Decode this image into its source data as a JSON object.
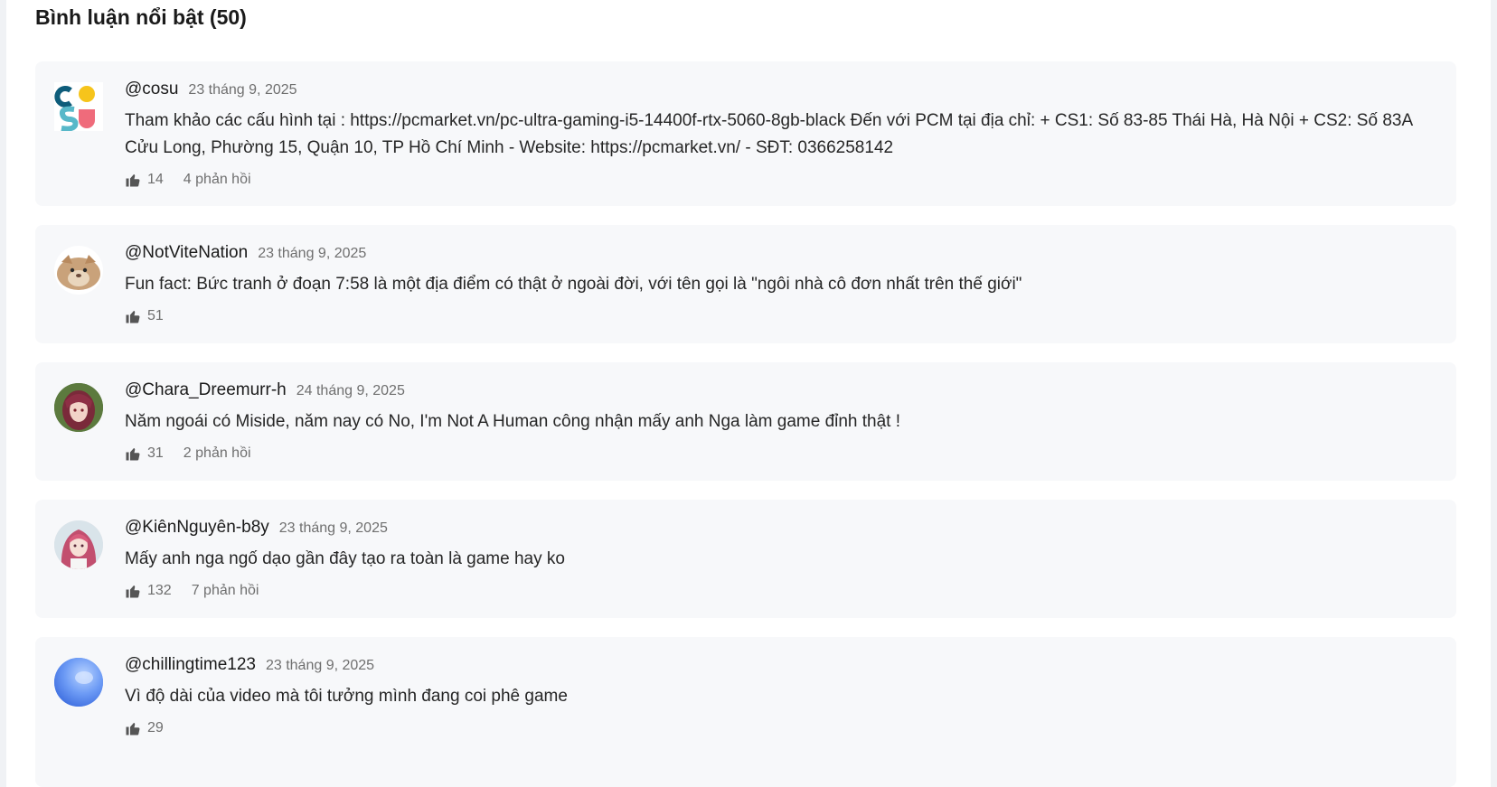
{
  "section": {
    "title": "Bình luận nổi bật (50)"
  },
  "comments": [
    {
      "author": "@cosu",
      "time": "23 tháng 9, 2025",
      "text": "Tham khảo các cấu hình tại : https://pcmarket.vn/pc-ultra-gaming-i5-14400f-rtx-5060-8gb-black Đến với PCM tại địa chỉ: + CS1: Số 83-85 Thái Hà, Hà Nội + CS2: Số 83A Cửu Long, Phường 15, Quận 10, TP Hồ Chí Minh - Website: https://pcmarket.vn/ - SĐT: 0366258142",
      "likes": "14",
      "replies": "4 phản hồi",
      "avatar_icon": "cosu-logo-icon"
    },
    {
      "author": "@NotViteNation",
      "time": "23 tháng 9, 2025",
      "text": "Fun fact: Bức tranh ở đoạn 7:58 là một địa điểm có thật ở ngoài đời, với tên gọi là \"ngôi nhà cô đơn nhất trên thế giới\"",
      "likes": "51",
      "replies": "",
      "avatar_icon": "cat-avatar-icon"
    },
    {
      "author": "@Chara_Dreemurr-h",
      "time": "24 tháng 9, 2025",
      "text": "Năm ngoái có Miside, năm nay có No, I'm Not A Human công nhận mấy anh Nga làm game đỉnh thật !",
      "likes": "31",
      "replies": "2 phản hồi",
      "avatar_icon": "anime-girl-avatar-icon"
    },
    {
      "author": "@KiênNguyên-b8y",
      "time": "23 tháng 9, 2025",
      "text": "Mấy anh nga ngố dạo gần đây tạo ra toàn là game hay ko",
      "likes": "132",
      "replies": "7 phản hồi",
      "avatar_icon": "pink-hair-avatar-icon"
    },
    {
      "author": "@chillingtime123",
      "time": "23 tháng 9, 2025",
      "text": "Vì độ dài của video mà tôi tưởng mình đang coi phê game",
      "likes": "29",
      "replies": "",
      "avatar_icon": "blue-orb-avatar-icon"
    }
  ],
  "colors": {
    "card_bg": "#f7f8fa",
    "time_gray": "#6f6f6f",
    "text": "#262626"
  }
}
